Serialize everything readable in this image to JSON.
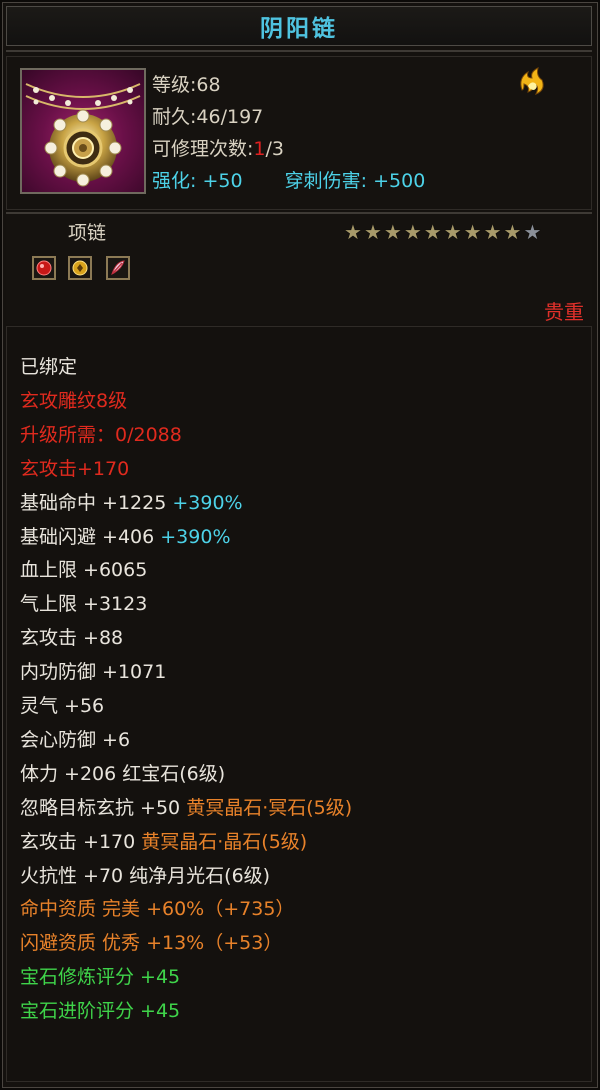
{
  "title": "阴阳链",
  "item": {
    "level_label": "等级:",
    "level_value": "68",
    "durability_label": "耐久:",
    "durability_value": "46/197",
    "repair_label": "可修理次数:",
    "repair_used": "1",
    "repair_total": "/3",
    "enhance_label": "强化:",
    "enhance_value": "+50",
    "pierce_label": "穿刺伤害:",
    "pierce_value": "+500",
    "type": "项链",
    "stars_filled": 9,
    "stars_total": 10,
    "rarity": "贵重"
  },
  "stats": [
    {
      "parts": [
        {
          "t": "已绑定",
          "c": "white"
        }
      ]
    },
    {
      "parts": [
        {
          "t": "玄攻雕纹8级",
          "c": "red"
        }
      ]
    },
    {
      "parts": [
        {
          "t": "升级所需：0/2088",
          "c": "red"
        }
      ]
    },
    {
      "parts": [
        {
          "t": "玄攻击+170",
          "c": "red"
        }
      ]
    },
    {
      "parts": [
        {
          "t": "基础命中 +1225 ",
          "c": "white"
        },
        {
          "t": "+390%",
          "c": "cyan"
        }
      ]
    },
    {
      "parts": [
        {
          "t": "基础闪避 +406 ",
          "c": "white"
        },
        {
          "t": "+390%",
          "c": "cyan"
        }
      ]
    },
    {
      "parts": [
        {
          "t": "血上限 +6065",
          "c": "white"
        }
      ]
    },
    {
      "parts": [
        {
          "t": "气上限 +3123",
          "c": "white"
        }
      ]
    },
    {
      "parts": [
        {
          "t": "玄攻击 +88",
          "c": "white"
        }
      ]
    },
    {
      "parts": [
        {
          "t": "内功防御 +1071",
          "c": "white"
        }
      ]
    },
    {
      "parts": [
        {
          "t": "灵气 +56",
          "c": "white"
        }
      ]
    },
    {
      "parts": [
        {
          "t": "会心防御 +6",
          "c": "white"
        }
      ]
    },
    {
      "parts": [
        {
          "t": "体力 +206 红宝石(6级)",
          "c": "white"
        }
      ]
    },
    {
      "parts": [
        {
          "t": "忽略目标玄抗 +50 ",
          "c": "white"
        },
        {
          "t": "黄冥晶石·冥石(5级)",
          "c": "orange"
        }
      ]
    },
    {
      "parts": [
        {
          "t": "玄攻击 +170 ",
          "c": "white"
        },
        {
          "t": "黄冥晶石·晶石(5级)",
          "c": "orange"
        }
      ]
    },
    {
      "parts": [
        {
          "t": "火抗性 +70 纯净月光石(6级)",
          "c": "white"
        }
      ]
    },
    {
      "parts": [
        {
          "t": "命中资质  完美 +60%（+735）",
          "c": "orange"
        }
      ]
    },
    {
      "parts": [
        {
          "t": "闪避资质  优秀 +13%（+53）",
          "c": "orange"
        }
      ]
    },
    {
      "parts": [
        {
          "t": "宝石修炼评分 +45",
          "c": "green"
        }
      ]
    },
    {
      "parts": [
        {
          "t": "宝石进阶评分 +45",
          "c": "green"
        }
      ]
    }
  ],
  "gem_slots": [
    "red-gem-icon",
    "gold-gem-icon",
    "feather-gem-icon"
  ]
}
